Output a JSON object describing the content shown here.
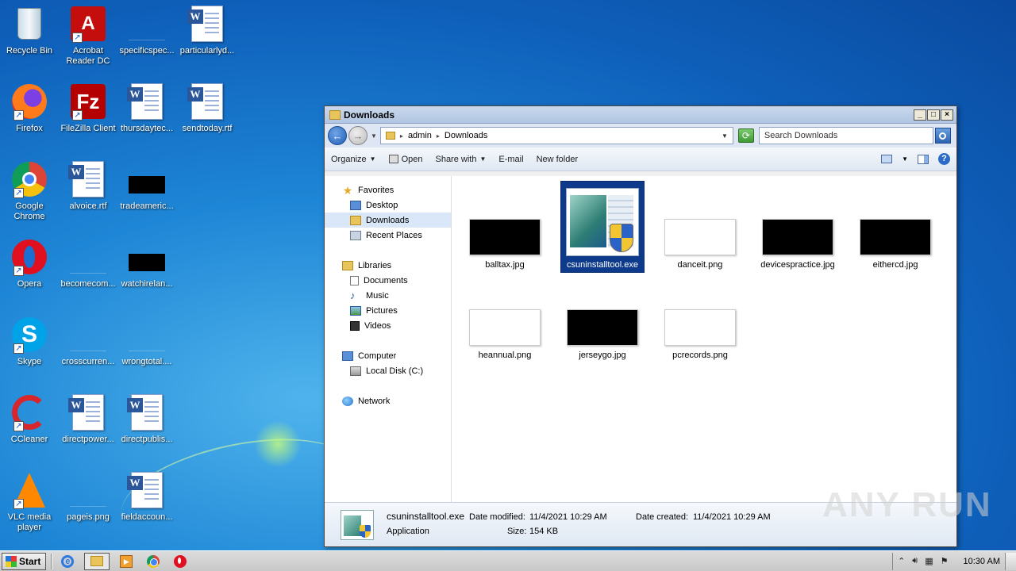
{
  "desktop": {
    "icons": [
      {
        "label": "Recycle Bin",
        "icon": "recycle-bin-icon"
      },
      {
        "label": "Acrobat\nReader DC",
        "icon": "acrobat-icon"
      },
      {
        "label": "specificspec...",
        "icon": "blank-file-icon"
      },
      {
        "label": "particularlyd...",
        "icon": "word-doc-icon"
      },
      {
        "label": "Firefox",
        "icon": "firefox-icon"
      },
      {
        "label": "FileZilla Client",
        "icon": "filezilla-icon"
      },
      {
        "label": "thursdaytec...",
        "icon": "word-doc-icon"
      },
      {
        "label": "sendtoday.rtf",
        "icon": "word-doc-icon"
      },
      {
        "label": "Google\nChrome",
        "icon": "chrome-icon"
      },
      {
        "label": "alvoice.rtf",
        "icon": "word-doc-icon"
      },
      {
        "label": "tradeameric...",
        "icon": "image-file-icon"
      },
      {
        "label": "Opera",
        "icon": "opera-icon"
      },
      {
        "label": "becomecom...",
        "icon": "blank-file-icon"
      },
      {
        "label": "watchirelan...",
        "icon": "image-file-icon"
      },
      {
        "label": "Skype",
        "icon": "skype-icon"
      },
      {
        "label": "crosscurren...",
        "icon": "blank-file-icon"
      },
      {
        "label": "wrongtotal....",
        "icon": "blank-file-icon"
      },
      {
        "label": "CCleaner",
        "icon": "ccleaner-icon"
      },
      {
        "label": "directpower...",
        "icon": "word-doc-icon"
      },
      {
        "label": "directpublis...",
        "icon": "word-doc-icon"
      },
      {
        "label": "VLC media\nplayer",
        "icon": "vlc-icon"
      },
      {
        "label": "pageis.png",
        "icon": "blank-file-icon"
      },
      {
        "label": "fieldaccoun...",
        "icon": "word-doc-icon"
      }
    ]
  },
  "window": {
    "title": "Downloads",
    "breadcrumb": [
      "admin",
      "Downloads"
    ],
    "search_placeholder": "Search Downloads",
    "toolbar": {
      "organize": "Organize",
      "open": "Open",
      "share_with": "Share with",
      "email": "E-mail",
      "new_folder": "New folder"
    },
    "nav": {
      "favorites": "Favorites",
      "desktop": "Desktop",
      "downloads": "Downloads",
      "recent_places": "Recent Places",
      "libraries": "Libraries",
      "documents": "Documents",
      "music": "Music",
      "pictures": "Pictures",
      "videos": "Videos",
      "computer": "Computer",
      "local_disk": "Local Disk (C:)",
      "network": "Network"
    },
    "files": [
      {
        "name": "balltax.jpg",
        "thumb": "black"
      },
      {
        "name": "csuninstalltool.exe",
        "thumb": "exe",
        "selected": true
      },
      {
        "name": "danceit.png",
        "thumb": "white"
      },
      {
        "name": "devicespractice.jpg",
        "thumb": "black"
      },
      {
        "name": "eithercd.jpg",
        "thumb": "black"
      },
      {
        "name": "heannual.png",
        "thumb": "white"
      },
      {
        "name": "jerseygo.jpg",
        "thumb": "black"
      },
      {
        "name": "pcrecords.png",
        "thumb": "white"
      }
    ],
    "details": {
      "name": "csuninstalltool.exe",
      "type": "Application",
      "date_modified_label": "Date modified:",
      "date_modified": "11/4/2021 10:29 AM",
      "date_created_label": "Date created:",
      "date_created": "11/4/2021 10:29 AM",
      "size_label": "Size:",
      "size": "154 KB"
    }
  },
  "watermark": "ANY RUN",
  "taskbar": {
    "start": "Start",
    "clock": "10:30 AM"
  }
}
